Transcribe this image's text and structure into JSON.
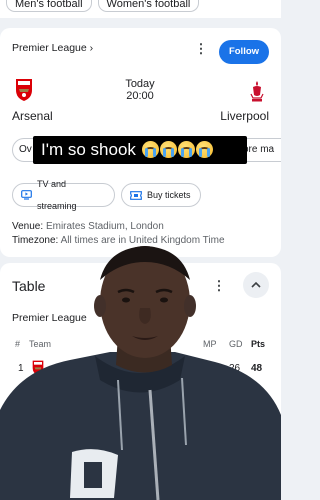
{
  "top_chips": [
    {
      "label": "Men's football"
    },
    {
      "label": "Women's football"
    }
  ],
  "match": {
    "league": "Premier League",
    "league_chevron": "›",
    "more_icon": "⋮",
    "follow_label": "Follow",
    "kickoff_day": "Today",
    "kickoff_time": "20:00",
    "home_team": "Arsenal",
    "away_team": "Liverpool",
    "tab_overview_partial": "Ov",
    "tab_more_partial": "ore ma",
    "tv_label": "TV and streaming",
    "tickets_label": "Buy tickets",
    "venue_label": "Venue:",
    "venue_value": "Emirates Stadium, London",
    "timezone_label": "Timezone:",
    "timezone_value": "All times are in United Kingdom Time",
    "accent_color": "#1a73e8"
  },
  "table": {
    "title": "Table",
    "more_icon": "⋮",
    "league": "Premier League",
    "headers": {
      "pos": "#",
      "team": "Team",
      "mp": "MP",
      "gd": "GD",
      "pts": "Pts"
    },
    "rows": [
      {
        "pos": "1",
        "team_crest": "arsenal-crest-icon",
        "gd": "26",
        "pts": "48"
      }
    ]
  },
  "caption": {
    "text": "I'm so shook",
    "emoji": "loudly-crying-face"
  }
}
